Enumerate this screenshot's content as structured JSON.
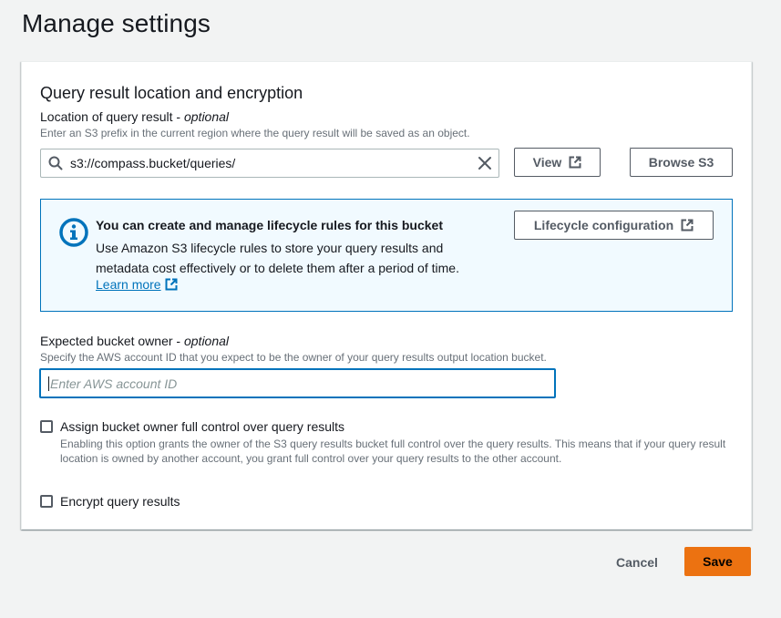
{
  "page": {
    "title": "Manage settings"
  },
  "section": {
    "title": "Query result location and encryption"
  },
  "location": {
    "label": "Location of query result",
    "label_suffix": "optional",
    "description": "Enter an S3 prefix in the current region where the query result will be saved as an object.",
    "value": "s3://compass.bucket/queries/",
    "view_button": "View",
    "browse_button": "Browse S3"
  },
  "info": {
    "heading": "You can create and manage lifecycle rules for this bucket",
    "text": "Use Amazon S3 lifecycle rules to store your query results and metadata cost effectively or to delete them after a period of time.",
    "link": "Learn more",
    "button": "Lifecycle configuration",
    "accent_color": "#0073bb"
  },
  "owner": {
    "label": "Expected bucket owner",
    "label_suffix": "optional",
    "description": "Specify the AWS account ID that you expect to be the owner of your query results output location bucket.",
    "placeholder": "Enter AWS account ID"
  },
  "full_control": {
    "label": "Assign bucket owner full control over query results",
    "description": "Enabling this option grants the owner of the S3 query results bucket full control over the query results. This means that if your query result location is owned by another account, you grant full control over your query results to the other account.",
    "checked": false
  },
  "encrypt": {
    "label": "Encrypt query results",
    "checked": false
  },
  "footer": {
    "cancel": "Cancel",
    "save": "Save",
    "save_color": "#ec7211"
  },
  "icons": [
    "search-icon",
    "clear-icon",
    "external-link-icon",
    "info-icon"
  ]
}
